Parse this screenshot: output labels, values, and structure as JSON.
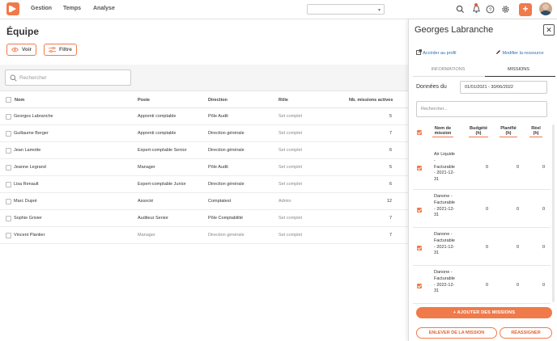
{
  "app": {
    "nav": [
      "Gestion",
      "Temps",
      "Analyse"
    ],
    "accent": "#f07a4a"
  },
  "page": {
    "title": "Équipe",
    "voir_label": "Voir",
    "filtre_label": "Filtre",
    "search_placeholder": "Rechercher"
  },
  "table": {
    "headers": [
      "Nom",
      "Poste",
      "Direction",
      "Rôle",
      "Nb. missions actives"
    ],
    "rows": [
      {
        "nom": "Georges Labranche",
        "poste": "Apprenti comptable",
        "direction": "Pôle Audit",
        "role": "Set complet",
        "missions": "5"
      },
      {
        "nom": "Guillaume Berger",
        "poste": "Apprenti comptable",
        "direction": "Direction générale",
        "role": "Set complet",
        "missions": "7"
      },
      {
        "nom": "Jean Lamotte",
        "poste": "Expert-comptable Senior",
        "direction": "Direction générale",
        "role": "Set complet",
        "missions": "6"
      },
      {
        "nom": "Jeanne Legrand",
        "poste": "Manager",
        "direction": "Pôle Audit",
        "role": "Set complet",
        "missions": "5"
      },
      {
        "nom": "Lisa Renault",
        "poste": "Expert-comptable Junior",
        "direction": "Direction générale",
        "role": "Set complet",
        "missions": "6"
      },
      {
        "nom": "Marc Dupré",
        "poste": "Associé",
        "direction": "Comptatest",
        "role": "Admin",
        "missions": "12"
      },
      {
        "nom": "Sophie Grisier",
        "poste": "Auditeur Senior",
        "direction": "Pôle Comptabilité",
        "role": "Set complet",
        "missions": "7"
      },
      {
        "nom": "Vincent Plantier",
        "poste": "Manager",
        "direction": "Direction générale",
        "role": "Set complet",
        "missions": "7"
      }
    ]
  },
  "panel": {
    "title": "Georges Labranche",
    "close": "✕",
    "link_profile": "Accéder au profil",
    "link_edit": "Modifier la ressource",
    "tabs": [
      "INFORMATIONS",
      "MISSIONS"
    ],
    "donnees_label": "Données du",
    "date_range": "01/01/2021  -  30/06/2022",
    "search_placeholder": "Rechercher...",
    "mission_headers": {
      "nom": "Nom de mission",
      "budgete": "Budgété (h)",
      "planifie": "Planifié (h)",
      "reel": "Réel (h)"
    },
    "missions": [
      {
        "name": "Air Liquide - Facturable - 2021-12-31",
        "budgete": "0",
        "planifie": "0",
        "reel": "0"
      },
      {
        "name": "Danone - Facturable - 2021-12-31",
        "budgete": "0",
        "planifie": "0",
        "reel": "0"
      },
      {
        "name": "Danone - Facturable - 2021-12-31",
        "budgete": "0",
        "planifie": "0",
        "reel": "0"
      },
      {
        "name": "Danone - Facturable - 2022-12-31",
        "budgete": "0",
        "planifie": "0",
        "reel": "0"
      }
    ],
    "add_button": "+ AJOUTER DES MISSIONS",
    "remove_button": "ENLEVER DE LA MISSION",
    "reassign_button": "RÉASSIGNER"
  }
}
